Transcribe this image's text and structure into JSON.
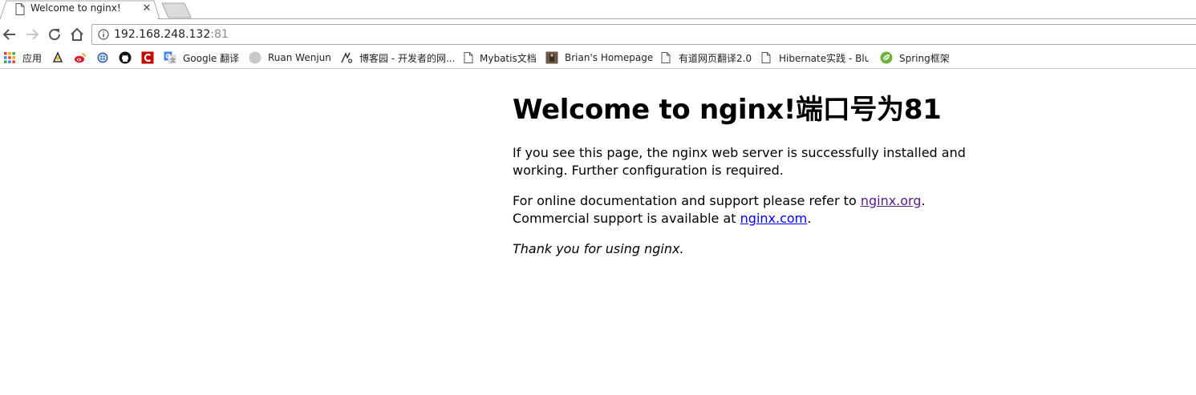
{
  "tab": {
    "title": "Welcome to nginx!",
    "close_glyph": "✕",
    "favicon": "page-icon"
  },
  "toolbar": {
    "back": "back-arrow-icon",
    "forward": "forward-arrow-icon",
    "reload": "reload-icon",
    "home": "home-icon",
    "url_host": "192.168.248.132",
    "url_port": ":81"
  },
  "bookmarks": [
    {
      "label": "应用",
      "icon": "apps-grid-icon"
    },
    {
      "label": "",
      "icon": "bookmark-icon"
    },
    {
      "label": "",
      "icon": "weibo-icon"
    },
    {
      "label": "",
      "icon": "globe-icon"
    },
    {
      "label": "",
      "icon": "github-icon"
    },
    {
      "label": "",
      "icon": "csdn-icon"
    },
    {
      "label": "Google 翻译",
      "icon": "google-translate-icon"
    },
    {
      "label": "Ruan Wenjun",
      "icon": "avatar-circle-icon"
    },
    {
      "label": "博客园 - 开发者的网...",
      "icon": "cnblogs-icon"
    },
    {
      "label": "Mybatis文档",
      "icon": "page-icon"
    },
    {
      "label": "Brian's Homepage",
      "icon": "photo-icon"
    },
    {
      "label": "有道网页翻译2.0",
      "icon": "page-icon"
    },
    {
      "label": "Hibernate实践 - Blu",
      "icon": "page-icon"
    },
    {
      "label": "Spring框架",
      "icon": "spring-leaf-icon"
    }
  ],
  "page": {
    "heading": "Welcome to nginx!端口号为81",
    "para1": "If you see this page, the nginx web server is successfully installed and working. Further configuration is required.",
    "para2_before": "For online documentation and support please refer to ",
    "link_org": "nginx.org",
    "para2_mid": ".",
    "para2_line2": "Commercial support is available at ",
    "link_com": "nginx.com",
    "para2_end": ".",
    "para3": "Thank you for using nginx."
  },
  "colors": {
    "link": "#0000ee",
    "visited_link": "#551a8b",
    "weibo_red": "#e6162d",
    "csdn_red": "#c90000",
    "spring_green": "#6db33f"
  }
}
